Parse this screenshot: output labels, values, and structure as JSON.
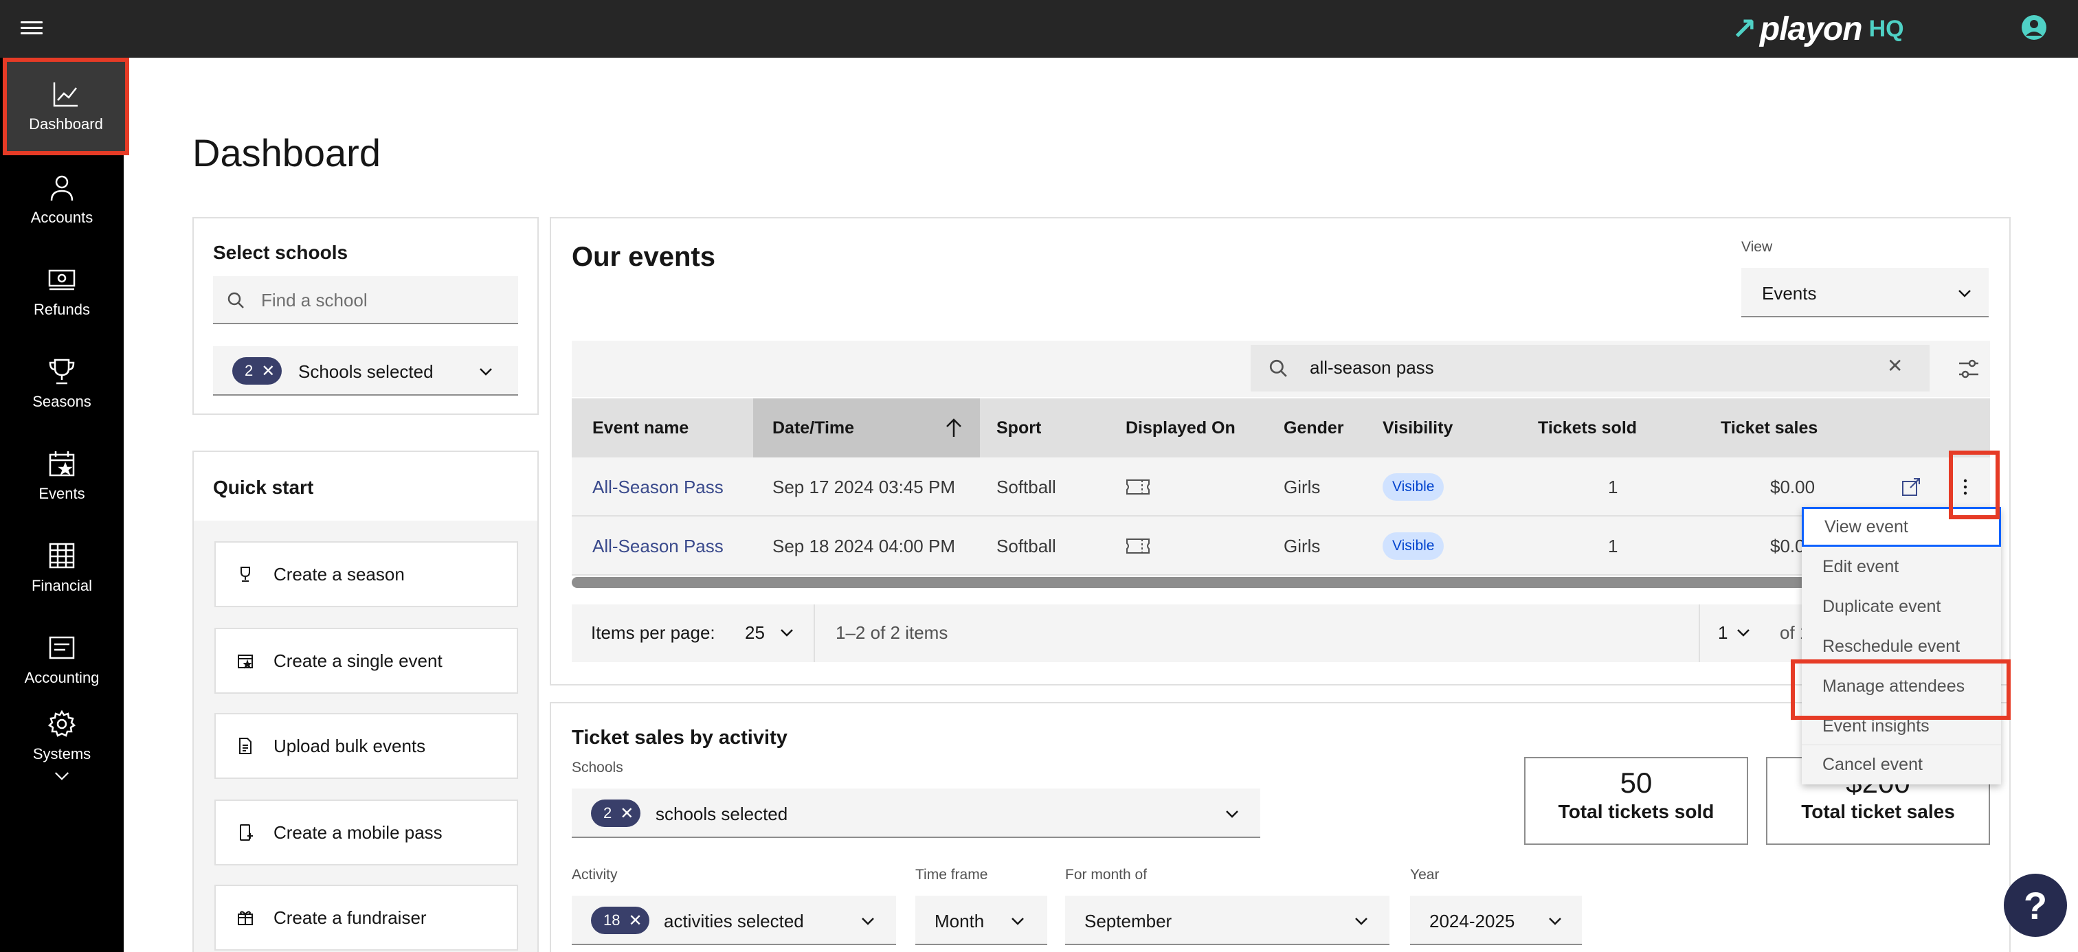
{
  "brand": {
    "logo_word": "playon",
    "logo_suffix": "HQ",
    "accent": "#4fd1c5",
    "highlight": "#e63b26"
  },
  "sidebar": {
    "items": [
      {
        "label": "Dashboard"
      },
      {
        "label": "Accounts"
      },
      {
        "label": "Refunds"
      },
      {
        "label": "Seasons"
      },
      {
        "label": "Events"
      },
      {
        "label": "Financial"
      },
      {
        "label": "Accounting"
      },
      {
        "label": "Systems"
      }
    ]
  },
  "page": {
    "title": "Dashboard"
  },
  "select_schools": {
    "title": "Select schools",
    "search_placeholder": "Find a school",
    "tag_count": "2",
    "selected_label": "Schools selected"
  },
  "quick_start": {
    "title": "Quick start",
    "items": [
      {
        "label": "Create a season"
      },
      {
        "label": "Create a single event"
      },
      {
        "label": "Upload bulk events"
      },
      {
        "label": "Create a mobile pass"
      },
      {
        "label": "Create a fundraiser"
      }
    ]
  },
  "events": {
    "title": "Our events",
    "view_label": "View",
    "view_value": "Events",
    "search_value": "all-season pass",
    "columns": [
      "Event name",
      "Date/Time",
      "Sport",
      "Displayed On",
      "Gender",
      "Visibility",
      "Tickets sold",
      "Ticket sales"
    ],
    "rows": [
      {
        "name": "All-Season Pass",
        "datetime": "Sep 17 2024 03:45 PM",
        "sport": "Softball",
        "gender": "Girls",
        "visibility": "Visible",
        "tickets_sold": "1",
        "ticket_sales": "$0.00"
      },
      {
        "name": "All-Season Pass",
        "datetime": "Sep 18 2024 04:00 PM",
        "sport": "Softball",
        "gender": "Girls",
        "visibility": "Visible",
        "tickets_sold": "1",
        "ticket_sales": "$0.0"
      }
    ],
    "pager": {
      "items_per_page_label": "Items per page:",
      "items_per_page": "25",
      "range": "1–2 of 2 items",
      "page": "1",
      "of_pages": "of 1"
    },
    "menu": [
      "View event",
      "Edit event",
      "Duplicate event",
      "Reschedule event",
      "Manage attendees",
      "Event insights",
      "Cancel event"
    ]
  },
  "sales": {
    "title": "Ticket sales by activity",
    "schools_label": "Schools",
    "schools_tag": "2",
    "schools_value": "schools selected",
    "activity_label": "Activity",
    "activity_tag": "18",
    "activity_value": "activities selected",
    "timeframe_label": "Time frame",
    "timeframe_value": "Month",
    "month_label": "For month of",
    "month_value": "September",
    "year_label": "Year",
    "year_value": "2024-2025",
    "total_tickets_value": "50",
    "total_tickets_label": "Total tickets sold",
    "total_sales_value": "$200",
    "total_sales_label": "Total ticket sales"
  },
  "help": {
    "label": "?"
  }
}
